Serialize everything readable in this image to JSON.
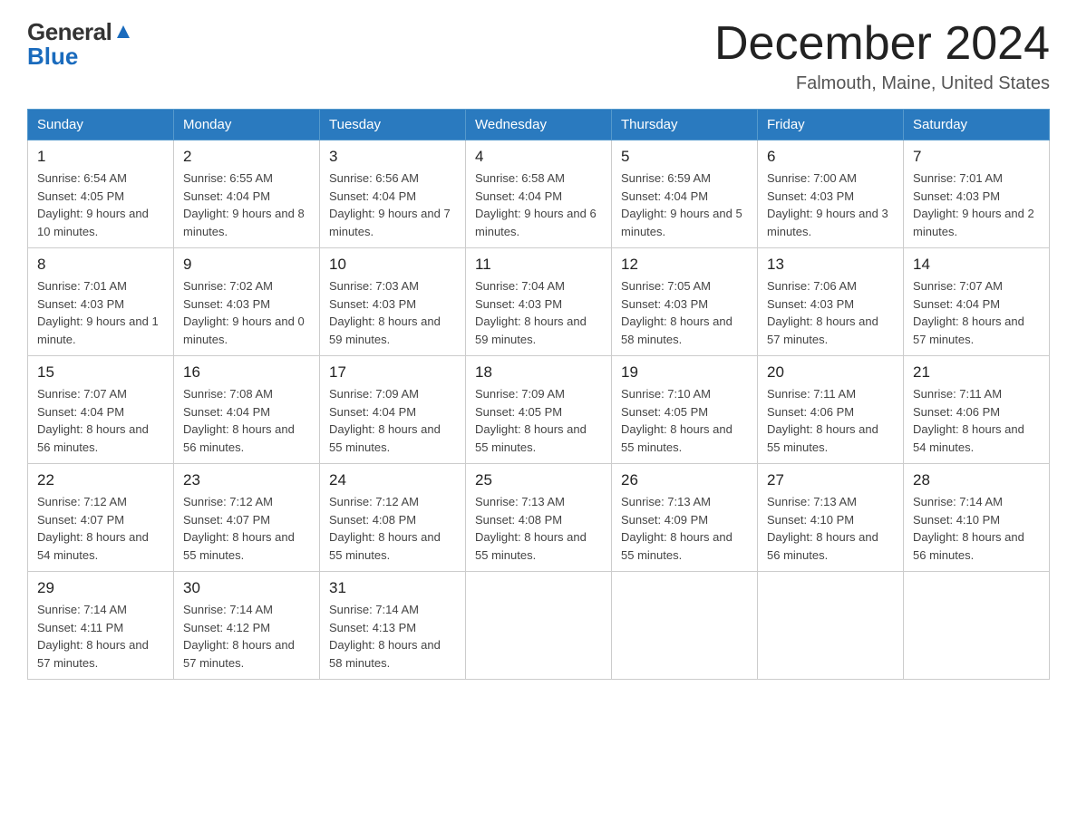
{
  "header": {
    "logo_general": "General",
    "logo_blue": "Blue",
    "month_title": "December 2024",
    "location": "Falmouth, Maine, United States"
  },
  "days_of_week": [
    "Sunday",
    "Monday",
    "Tuesday",
    "Wednesday",
    "Thursday",
    "Friday",
    "Saturday"
  ],
  "weeks": [
    [
      {
        "day": "1",
        "sunrise": "Sunrise: 6:54 AM",
        "sunset": "Sunset: 4:05 PM",
        "daylight": "Daylight: 9 hours and 10 minutes."
      },
      {
        "day": "2",
        "sunrise": "Sunrise: 6:55 AM",
        "sunset": "Sunset: 4:04 PM",
        "daylight": "Daylight: 9 hours and 8 minutes."
      },
      {
        "day": "3",
        "sunrise": "Sunrise: 6:56 AM",
        "sunset": "Sunset: 4:04 PM",
        "daylight": "Daylight: 9 hours and 7 minutes."
      },
      {
        "day": "4",
        "sunrise": "Sunrise: 6:58 AM",
        "sunset": "Sunset: 4:04 PM",
        "daylight": "Daylight: 9 hours and 6 minutes."
      },
      {
        "day": "5",
        "sunrise": "Sunrise: 6:59 AM",
        "sunset": "Sunset: 4:04 PM",
        "daylight": "Daylight: 9 hours and 5 minutes."
      },
      {
        "day": "6",
        "sunrise": "Sunrise: 7:00 AM",
        "sunset": "Sunset: 4:03 PM",
        "daylight": "Daylight: 9 hours and 3 minutes."
      },
      {
        "day": "7",
        "sunrise": "Sunrise: 7:01 AM",
        "sunset": "Sunset: 4:03 PM",
        "daylight": "Daylight: 9 hours and 2 minutes."
      }
    ],
    [
      {
        "day": "8",
        "sunrise": "Sunrise: 7:01 AM",
        "sunset": "Sunset: 4:03 PM",
        "daylight": "Daylight: 9 hours and 1 minute."
      },
      {
        "day": "9",
        "sunrise": "Sunrise: 7:02 AM",
        "sunset": "Sunset: 4:03 PM",
        "daylight": "Daylight: 9 hours and 0 minutes."
      },
      {
        "day": "10",
        "sunrise": "Sunrise: 7:03 AM",
        "sunset": "Sunset: 4:03 PM",
        "daylight": "Daylight: 8 hours and 59 minutes."
      },
      {
        "day": "11",
        "sunrise": "Sunrise: 7:04 AM",
        "sunset": "Sunset: 4:03 PM",
        "daylight": "Daylight: 8 hours and 59 minutes."
      },
      {
        "day": "12",
        "sunrise": "Sunrise: 7:05 AM",
        "sunset": "Sunset: 4:03 PM",
        "daylight": "Daylight: 8 hours and 58 minutes."
      },
      {
        "day": "13",
        "sunrise": "Sunrise: 7:06 AM",
        "sunset": "Sunset: 4:03 PM",
        "daylight": "Daylight: 8 hours and 57 minutes."
      },
      {
        "day": "14",
        "sunrise": "Sunrise: 7:07 AM",
        "sunset": "Sunset: 4:04 PM",
        "daylight": "Daylight: 8 hours and 57 minutes."
      }
    ],
    [
      {
        "day": "15",
        "sunrise": "Sunrise: 7:07 AM",
        "sunset": "Sunset: 4:04 PM",
        "daylight": "Daylight: 8 hours and 56 minutes."
      },
      {
        "day": "16",
        "sunrise": "Sunrise: 7:08 AM",
        "sunset": "Sunset: 4:04 PM",
        "daylight": "Daylight: 8 hours and 56 minutes."
      },
      {
        "day": "17",
        "sunrise": "Sunrise: 7:09 AM",
        "sunset": "Sunset: 4:04 PM",
        "daylight": "Daylight: 8 hours and 55 minutes."
      },
      {
        "day": "18",
        "sunrise": "Sunrise: 7:09 AM",
        "sunset": "Sunset: 4:05 PM",
        "daylight": "Daylight: 8 hours and 55 minutes."
      },
      {
        "day": "19",
        "sunrise": "Sunrise: 7:10 AM",
        "sunset": "Sunset: 4:05 PM",
        "daylight": "Daylight: 8 hours and 55 minutes."
      },
      {
        "day": "20",
        "sunrise": "Sunrise: 7:11 AM",
        "sunset": "Sunset: 4:06 PM",
        "daylight": "Daylight: 8 hours and 55 minutes."
      },
      {
        "day": "21",
        "sunrise": "Sunrise: 7:11 AM",
        "sunset": "Sunset: 4:06 PM",
        "daylight": "Daylight: 8 hours and 54 minutes."
      }
    ],
    [
      {
        "day": "22",
        "sunrise": "Sunrise: 7:12 AM",
        "sunset": "Sunset: 4:07 PM",
        "daylight": "Daylight: 8 hours and 54 minutes."
      },
      {
        "day": "23",
        "sunrise": "Sunrise: 7:12 AM",
        "sunset": "Sunset: 4:07 PM",
        "daylight": "Daylight: 8 hours and 55 minutes."
      },
      {
        "day": "24",
        "sunrise": "Sunrise: 7:12 AM",
        "sunset": "Sunset: 4:08 PM",
        "daylight": "Daylight: 8 hours and 55 minutes."
      },
      {
        "day": "25",
        "sunrise": "Sunrise: 7:13 AM",
        "sunset": "Sunset: 4:08 PM",
        "daylight": "Daylight: 8 hours and 55 minutes."
      },
      {
        "day": "26",
        "sunrise": "Sunrise: 7:13 AM",
        "sunset": "Sunset: 4:09 PM",
        "daylight": "Daylight: 8 hours and 55 minutes."
      },
      {
        "day": "27",
        "sunrise": "Sunrise: 7:13 AM",
        "sunset": "Sunset: 4:10 PM",
        "daylight": "Daylight: 8 hours and 56 minutes."
      },
      {
        "day": "28",
        "sunrise": "Sunrise: 7:14 AM",
        "sunset": "Sunset: 4:10 PM",
        "daylight": "Daylight: 8 hours and 56 minutes."
      }
    ],
    [
      {
        "day": "29",
        "sunrise": "Sunrise: 7:14 AM",
        "sunset": "Sunset: 4:11 PM",
        "daylight": "Daylight: 8 hours and 57 minutes."
      },
      {
        "day": "30",
        "sunrise": "Sunrise: 7:14 AM",
        "sunset": "Sunset: 4:12 PM",
        "daylight": "Daylight: 8 hours and 57 minutes."
      },
      {
        "day": "31",
        "sunrise": "Sunrise: 7:14 AM",
        "sunset": "Sunset: 4:13 PM",
        "daylight": "Daylight: 8 hours and 58 minutes."
      },
      null,
      null,
      null,
      null
    ]
  ]
}
